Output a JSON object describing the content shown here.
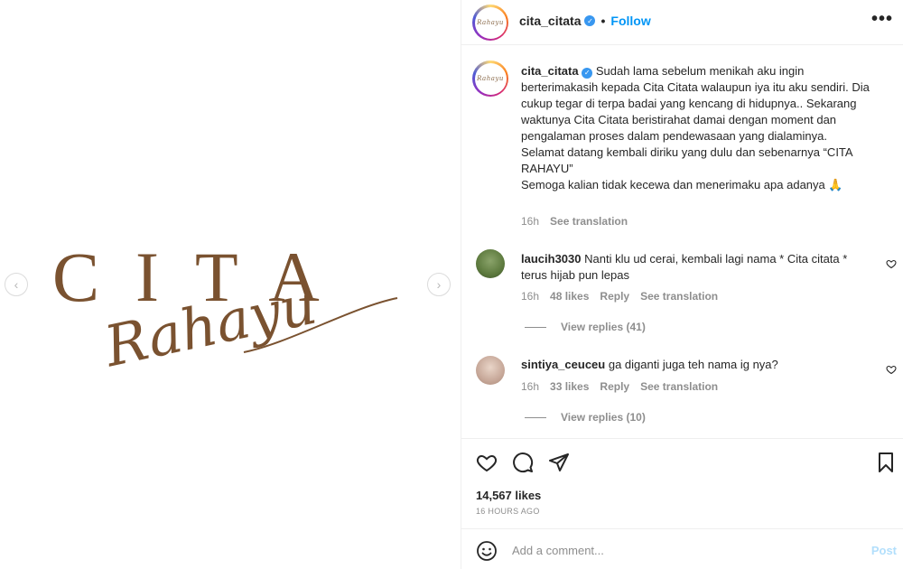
{
  "media": {
    "logo_main": "CITA",
    "logo_script": "Rahayu",
    "prev_icon": "chevron-left-icon",
    "next_icon": "chevron-right-icon",
    "logo_color": "#7a5230"
  },
  "header": {
    "avatar_text": "Rahayu",
    "username": "cita_citata",
    "dot": "•",
    "follow_label": "Follow",
    "more_label": "•••"
  },
  "caption": {
    "username": "cita_citata",
    "text": "Sudah lama sebelum menikah aku ingin berterimakasih kepada Cita Citata walaupun iya itu aku sendiri. Dia cukup tegar di terpa badai yang kencang di hidupnya.. Sekarang waktunya Cita Citata beristirahat damai dengan moment dan pengalaman proses dalam pendewasaan yang dialaminya.",
    "text2": "Selamat datang kembali diriku yang dulu dan sebenarnya “CITA RAHAYU”",
    "text3": "Semoga kalian tidak kecewa dan menerimaku apa adanya 🙏",
    "time": "16h",
    "see_translation": "See translation"
  },
  "comments": [
    {
      "username": "laucih3030",
      "text": "Nanti klu ud cerai, kembali lagi nama * Cita citata * terus hijab pun lepas",
      "time": "16h",
      "likes": "48 likes",
      "reply": "Reply",
      "see_translation": "See translation",
      "view_replies": "View replies (41)"
    },
    {
      "username": "sintiya_ceuceu",
      "text": "ga diganti juga teh nama ig nya?",
      "time": "16h",
      "likes": "33 likes",
      "reply": "Reply",
      "see_translation": "See translation",
      "view_replies": "View replies (10)"
    }
  ],
  "actions": {
    "likes": "14,567 likes",
    "time": "16 HOURS AGO"
  },
  "add_comment": {
    "placeholder": "Add a comment...",
    "post_label": "Post"
  },
  "colors": {
    "accent": "#0095f6",
    "post_disabled": "#b2dffc",
    "muted": "#8e8e8e"
  }
}
